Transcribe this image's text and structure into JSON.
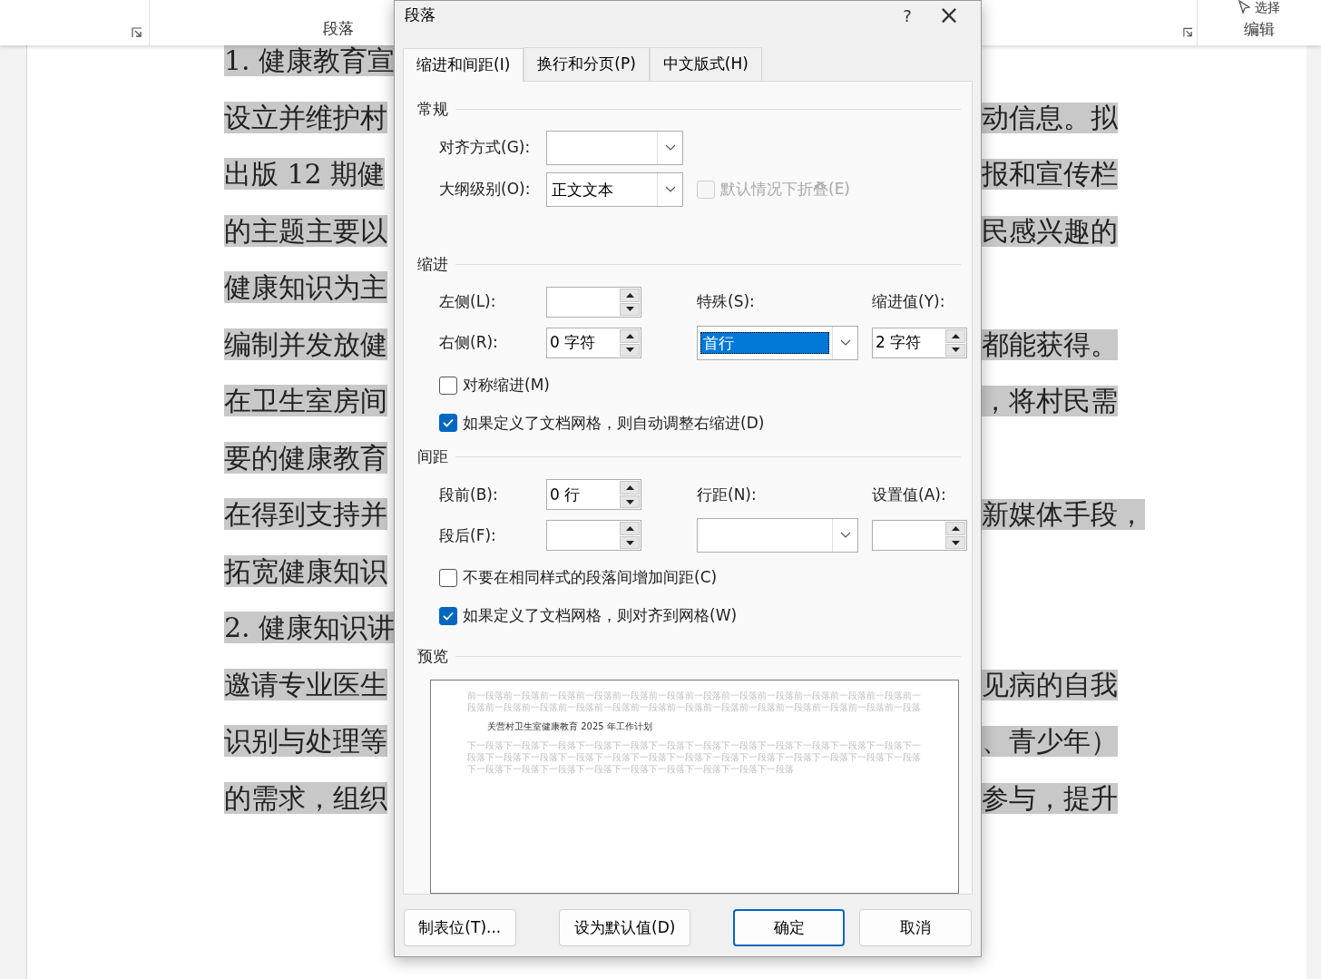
{
  "ribbon": {
    "paragraph_group": "段落",
    "editing_group": "编辑",
    "select_button": "选择"
  },
  "document": {
    "lines": [
      {
        "left": "1. 健康教育宣"
      },
      {
        "left": "设立并维护村",
        "right": "动信息。拟"
      },
      {
        "left": "出版 12 期健",
        "right": "报和宣传栏"
      },
      {
        "left": "的主题主要以",
        "right": "民感兴趣的"
      },
      {
        "left": "健康知识为主"
      },
      {
        "left": "编制并发放健",
        "right": "都能获得。"
      },
      {
        "left": "在卫生室房间",
        "right": "，将村民需"
      },
      {
        "left": "要的健康教育"
      },
      {
        "left": "在得到支持并",
        "right": "新媒体手段，"
      },
      {
        "left": "拓宽健康知识"
      },
      {
        "left": "2. 健康知识讲"
      },
      {
        "left": "邀请专业医生",
        "right": "见病的自我"
      },
      {
        "left": "识别与处理等",
        "right": "、青少年）"
      },
      {
        "left": "的需求，组织",
        "right": "参与，提升"
      }
    ]
  },
  "dialog": {
    "title": "段落",
    "help": "?",
    "close": "×",
    "tabs": [
      {
        "label": "缩进和间距(I)",
        "selected": true
      },
      {
        "label": "换行和分页(P)",
        "selected": false
      },
      {
        "label": "中文版式(H)",
        "selected": false
      }
    ],
    "general": {
      "heading": "常规",
      "alignment": {
        "label": "对齐方式(G):"
      },
      "outline": {
        "label": "大纲级别(O):",
        "value": "正文文本"
      },
      "collapse": {
        "label": "默认情况下折叠(E)",
        "checked": false,
        "disabled": true
      }
    },
    "indentation": {
      "heading": "缩进",
      "left": {
        "label": "左侧(L):"
      },
      "right": {
        "label": "右侧(R):",
        "value": "0 字符"
      },
      "special": {
        "label": "特殊(S):",
        "value": "首行",
        "selected": true
      },
      "by": {
        "label": "缩进值(Y):",
        "value": "2 字符"
      },
      "checkboxes": [
        {
          "label": "对称缩进(M)",
          "checked": false
        },
        {
          "label": "如果定义了文档网格，则自动调整右缩进(D)",
          "checked": true
        }
      ]
    },
    "spacing": {
      "heading": "间距",
      "before": {
        "label": "段前(B):",
        "value": "0 行"
      },
      "after": {
        "label": "段后(F):"
      },
      "line_spacing": {
        "label": "行距(N):"
      },
      "at": {
        "label": "设置值(A):"
      },
      "checkboxes": [
        {
          "label": "不要在相同样式的段落间增加间距(C)",
          "checked": false
        },
        {
          "label": "如果定义了文档网格，则对齐到网格(W)",
          "checked": true
        }
      ]
    },
    "preview": {
      "heading": "预览",
      "previous_text": "前一段落前一段落前一段落前一段落前一段落前一段落前一段落前一段落前一段落前一段落前一段落前一段落前一段落前一段落前一段落前一段落前一段落前一段落前一段落前一段落前一段落前一段落前一段落前一段落前一段落",
      "sample_text": "关营村卫生室健康教育 2025 年工作计划",
      "next_text": "下一段落下一段落下一段落下一段落下一段落下一段落下一段落下一段落下一段落下一段落下一段落下一段落下一段落下一段落下一段落下一段落下一段落下一段落下一段落下一段落下一段落下一段落下一段落下一段落下一段落下一段落下一段落下一段落下一段落下一段落下一段落下一段落下一段落下一段落"
    },
    "buttons": [
      {
        "label": "制表位(T)...",
        "primary": false
      },
      {
        "label": "设为默认值(D)",
        "primary": false
      },
      {
        "label": "确定",
        "primary": true
      },
      {
        "label": "取消",
        "primary": false
      }
    ]
  }
}
